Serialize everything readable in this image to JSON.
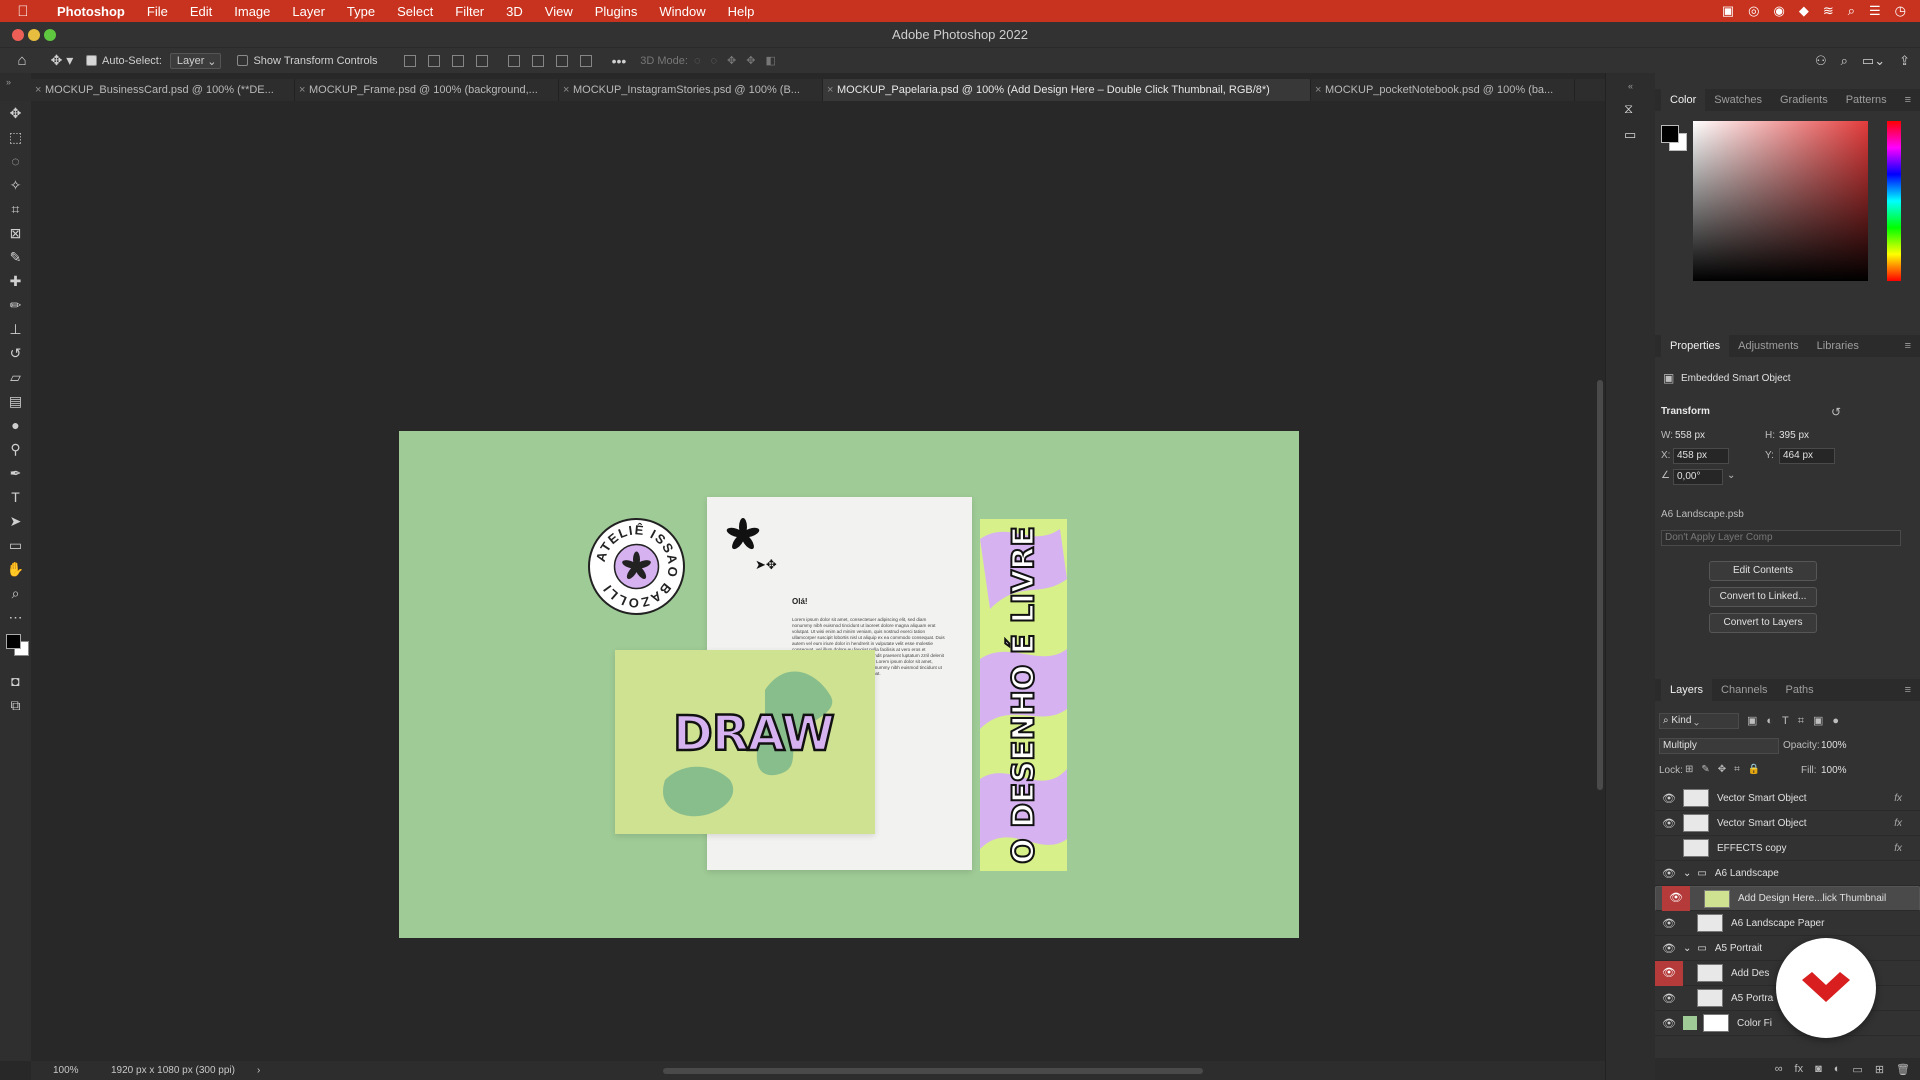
{
  "menubar": {
    "app_name": "Photoshop",
    "items": [
      "File",
      "Edit",
      "Image",
      "Layer",
      "Type",
      "Select",
      "Filter",
      "3D",
      "View",
      "Plugins",
      "Window",
      "Help"
    ]
  },
  "window": {
    "title": "Adobe Photoshop 2022"
  },
  "options_bar": {
    "auto_select_label": "Auto-Select:",
    "auto_select_value": "Layer",
    "show_transform_label": "Show Transform Controls",
    "three_d_mode_label": "3D Mode:"
  },
  "tabs": [
    {
      "label": "MOCKUP_BusinessCard.psd @ 100% (**DE..."
    },
    {
      "label": "MOCKUP_Frame.psd @ 100% (background,..."
    },
    {
      "label": "MOCKUP_InstagramStories.psd @ 100% (B..."
    },
    {
      "label": "MOCKUP_Papelaria.psd @ 100% (Add Design Here – Double Click Thumbnail, RGB/8*)"
    },
    {
      "label": "MOCKUP_pocketNotebook.psd @ 100% (ba..."
    }
  ],
  "document": {
    "sticker_text": "ATELIÊ ISSAO BAZOLLI",
    "letter_greeting": "Olá!",
    "letter_body": "Lorem ipsum dolor sit amet, consectetuer adipiscing elit, sed diam nonummy nibh euismod tincidunt ut laoreet dolore magna aliquam erat volutpat. Ut wisi enim ad minim veniam, quis nostrud exerci tation ullamcorper suscipit lobortis nisl ut aliquip ex ea commodo consequat. Duis autem vel eum iriure dolor in hendrerit in vulputate velit esse molestie consequat, vel illum dolore eu feugiat nulla facilisis at vero eros et accumsan et iusto odio dignissim qui blandit praesent luptatum zzril delenit augue duis dolore te feugait nulla facilisi. Lorem ipsum dolor sit amet, consectetuer adipiscing elit, sed diam nonummy nibh euismod tincidunt ut laoreet dolore magna aliquam erat volutpat.",
    "card_text": "DRAW",
    "bookmark_text": "O DESENHO É LIVRE"
  },
  "status": {
    "zoom": "100%",
    "doc_size": "1920 px x 1080 px (300 ppi)"
  },
  "color_panel": {
    "tabs": [
      "Color",
      "Swatches",
      "Gradients",
      "Patterns"
    ]
  },
  "properties_panel": {
    "tabs": [
      "Properties",
      "Adjustments",
      "Libraries"
    ],
    "type_label": "Embedded Smart Object",
    "section": "Transform",
    "w_label": "W:",
    "w_value": "558 px",
    "h_label": "H:",
    "h_value": "395 px",
    "x_label": "X:",
    "x_value": "458 px",
    "y_label": "Y:",
    "y_value": "464 px",
    "angle_value": "0,00°",
    "file_name": "A6 Landscape.psb",
    "layer_comp": "Don't Apply Layer Comp",
    "buttons": [
      "Edit Contents",
      "Convert to Linked...",
      "Convert to Layers"
    ]
  },
  "layers_panel": {
    "tabs": [
      "Layers",
      "Channels",
      "Paths"
    ],
    "filter_kind": "Kind",
    "blend_mode": "Multiply",
    "opacity_label": "Opacity:",
    "opacity_value": "100%",
    "lock_label": "Lock:",
    "fill_label": "Fill:",
    "fill_value": "100%",
    "layers": [
      {
        "name": "Vector Smart Object",
        "fx": "fx",
        "indent": 0,
        "visible": true
      },
      {
        "name": "Vector Smart Object",
        "fx": "fx",
        "indent": 0,
        "visible": true
      },
      {
        "name": "EFFECTS copy",
        "fx": "fx",
        "indent": 0,
        "visible": false
      },
      {
        "name": "A6 Landscape",
        "fx": "",
        "indent": 0,
        "group": true,
        "visible": true
      },
      {
        "name": "Add Design Here...lick Thumbnail",
        "fx": "",
        "indent": 1,
        "visible": true,
        "selected": true
      },
      {
        "name": "A6 Landscape Paper",
        "fx": "",
        "indent": 1,
        "visible": true
      },
      {
        "name": "A5 Portrait",
        "fx": "",
        "indent": 0,
        "group": true,
        "visible": true
      },
      {
        "name": "Add Des",
        "fx": "",
        "indent": 1,
        "visible": true
      },
      {
        "name": "A5 Portra",
        "fx": "",
        "indent": 1,
        "visible": true
      },
      {
        "name": "Color Fi",
        "fx": "",
        "indent": 0,
        "visible": true
      }
    ]
  },
  "colors": {
    "menubar": "#c8331f",
    "canvas_bg": "#9fcb96",
    "card_bg": "#cfe291",
    "lilac": "#d6b3f0",
    "selected_eye": "#b53a3a"
  }
}
